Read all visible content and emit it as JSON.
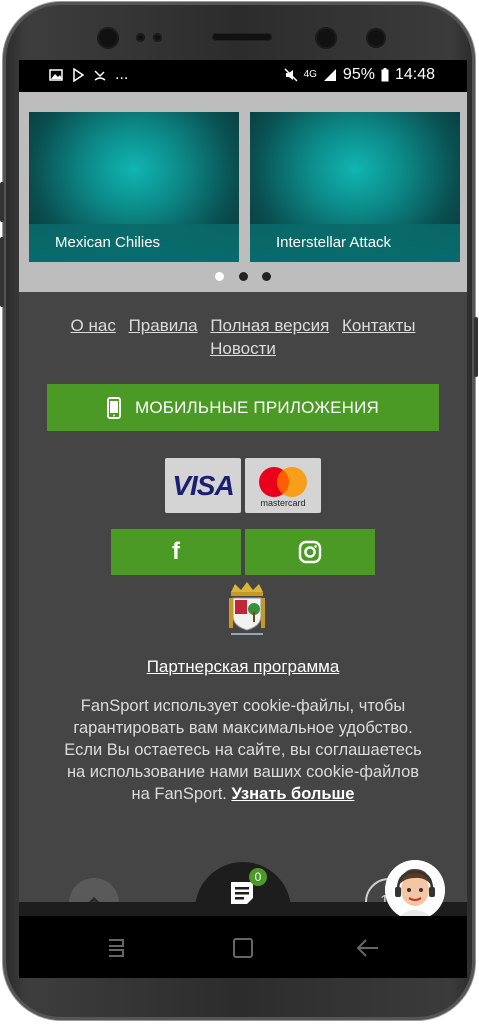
{
  "status_bar": {
    "dots": "...",
    "network": "4G",
    "battery": "95%",
    "time": "14:48"
  },
  "slider": {
    "games": [
      {
        "title": "Mexican Chilies"
      },
      {
        "title": "Interstellar Attack"
      }
    ],
    "page_count": 3,
    "active_page": 1
  },
  "footer_links": {
    "about": "О нас",
    "rules": "Правила",
    "full_version": "Полная версия",
    "contacts": "Контакты",
    "news": "Новости"
  },
  "mobile_apps_button": "МОБИЛЬНЫЕ ПРИЛОЖЕНИЯ",
  "payments": {
    "visa": "VISA",
    "mastercard": "mastercard"
  },
  "social": {
    "facebook": "f",
    "instagram_icon": "instagram-icon"
  },
  "partner_program": "Партнерская программа",
  "cookie": {
    "text": "FanSport использует cookie-файлы, чтобы гарантировать вам максимальное удобство. Если Вы остаетесь на сайте, вы соглашаетесь на использование нами ваших cookie-файлов на FanSport.",
    "more": "Узнать больше"
  },
  "age_badge": "18",
  "betslip_count": "0",
  "colors": {
    "accent_green": "#4c9a26",
    "page_bg": "#454545"
  }
}
